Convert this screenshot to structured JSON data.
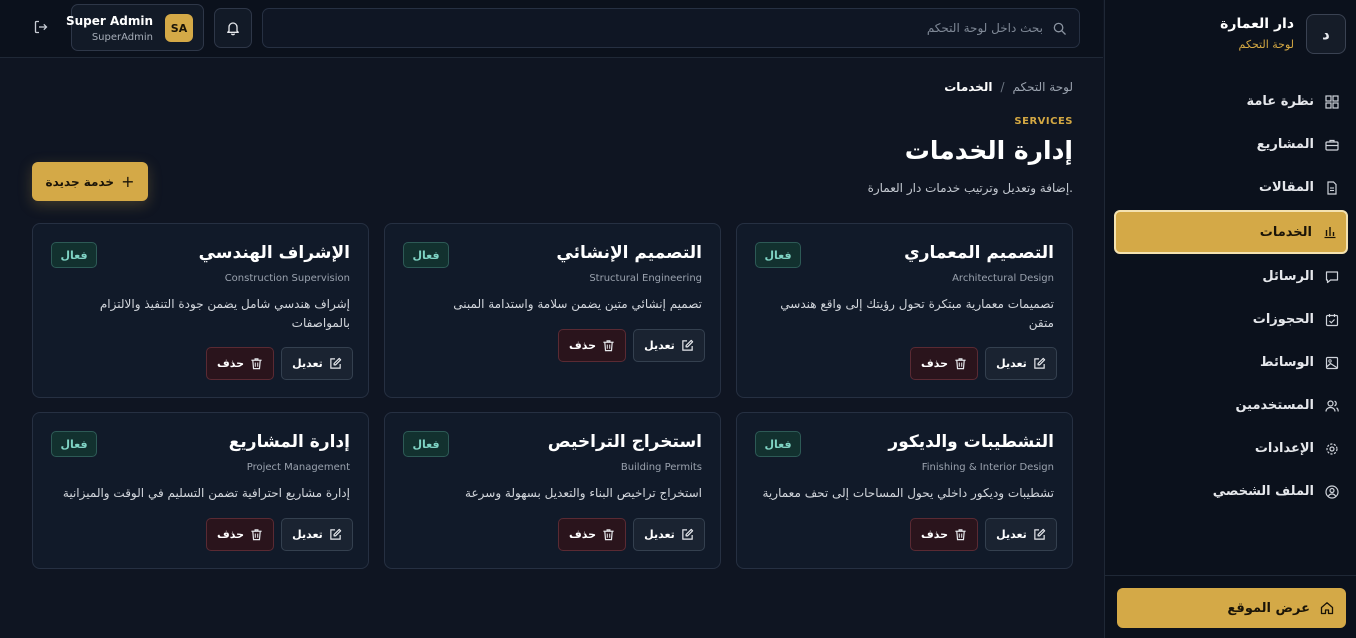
{
  "brand": {
    "logo_letter": "د",
    "name": "دار العمارة",
    "subtitle": "لوحة التحكم"
  },
  "sidebar": {
    "items": [
      {
        "label": "نظرة عامة",
        "icon": "grid-icon"
      },
      {
        "label": "المشاريع",
        "icon": "briefcase-icon"
      },
      {
        "label": "المقالات",
        "icon": "document-icon"
      },
      {
        "label": "الخدمات",
        "icon": "bar-chart-icon",
        "active": true
      },
      {
        "label": "الرسائل",
        "icon": "message-icon"
      },
      {
        "label": "الحجوزات",
        "icon": "calendar-check-icon"
      },
      {
        "label": "الوسائط",
        "icon": "image-icon"
      },
      {
        "label": "المستخدمين",
        "icon": "users-icon"
      },
      {
        "label": "الإعدادات",
        "icon": "gear-icon"
      },
      {
        "label": "الملف الشخصي",
        "icon": "user-circle-icon"
      }
    ],
    "view_site_label": "عرض الموقع"
  },
  "topbar": {
    "search_placeholder": "بحث داخل لوحة التحكم",
    "user": {
      "initials": "SA",
      "name": "Super Admin",
      "role": "SuperAdmin"
    }
  },
  "breadcrumb": {
    "root": "لوحة التحكم",
    "separator": "/",
    "current": "الخدمات"
  },
  "page": {
    "eyebrow": "SERVICES",
    "title": "إدارة الخدمات",
    "subtitle": "إضافة وتعديل وترتيب خدمات دار العمارة.",
    "new_button_label": "خدمة جديدة"
  },
  "cards": [
    {
      "title": "التصميم المعماري",
      "en": "Architectural Design",
      "desc": "تصميمات معمارية مبتكرة تحول رؤيتك إلى واقع هندسي متقن",
      "status": "فعال",
      "edit": "تعديل",
      "delete": "حذف"
    },
    {
      "title": "التصميم الإنشائي",
      "en": "Structural Engineering",
      "desc": "تصميم إنشائي متين يضمن سلامة واستدامة المبنى",
      "status": "فعال",
      "edit": "تعديل",
      "delete": "حذف"
    },
    {
      "title": "الإشراف الهندسي",
      "en": "Construction Supervision",
      "desc": "إشراف هندسي شامل يضمن جودة التنفيذ والالتزام بالمواصفات",
      "status": "فعال",
      "edit": "تعديل",
      "delete": "حذف"
    },
    {
      "title": "التشطيبات والديكور",
      "en": "Finishing & Interior Design",
      "desc": "تشطيبات وديكور داخلي يحول المساحات إلى تحف معمارية",
      "status": "فعال",
      "edit": "تعديل",
      "delete": "حذف"
    },
    {
      "title": "استخراج التراخيص",
      "en": "Building Permits",
      "desc": "استخراج تراخيص البناء والتعديل بسهولة وسرعة",
      "status": "فعال",
      "edit": "تعديل",
      "delete": "حذف"
    },
    {
      "title": "إدارة المشاريع",
      "en": "Project Management",
      "desc": "إدارة مشاريع احترافية تضمن التسليم في الوقت والميزانية",
      "status": "فعال",
      "edit": "تعديل",
      "delete": "حذف"
    }
  ],
  "colors": {
    "accent": "#d4a947",
    "background": "#0f1522",
    "status_active": "#7fd3c4"
  }
}
